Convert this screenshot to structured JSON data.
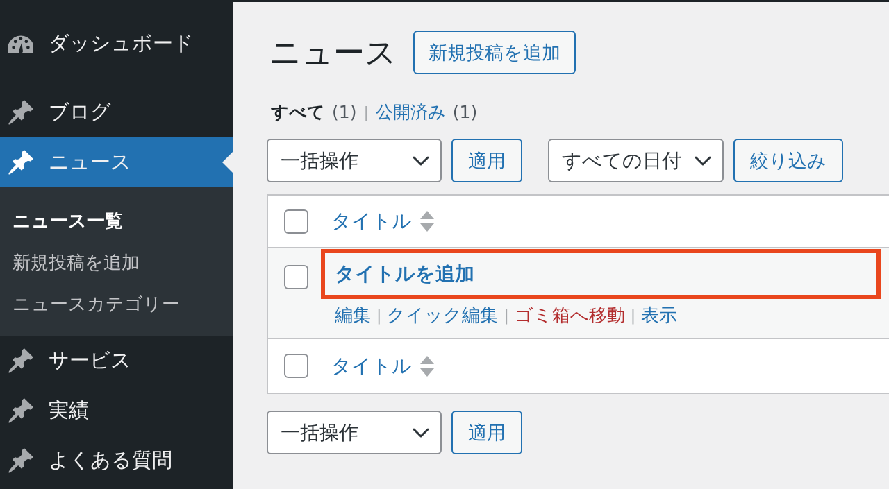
{
  "sidebar": {
    "items": [
      {
        "label": "ダッシュボード",
        "kind": "dashboard",
        "selected": false
      },
      {
        "label": "ブログ",
        "kind": "post",
        "selected": false
      },
      {
        "label": "ニュース",
        "kind": "post",
        "selected": true,
        "children": [
          {
            "label": "ニュース一覧",
            "selected": true
          },
          {
            "label": "新規投稿を追加",
            "selected": false
          },
          {
            "label": "ニュースカテゴリー",
            "selected": false
          }
        ]
      },
      {
        "label": "サービス",
        "kind": "post",
        "selected": false
      },
      {
        "label": "実績",
        "kind": "post",
        "selected": false
      },
      {
        "label": "よくある質問",
        "kind": "post",
        "selected": false
      }
    ]
  },
  "page": {
    "title": "ニュース",
    "add_button": "新規投稿を追加"
  },
  "views": [
    {
      "label": "すべて",
      "count": "(1)",
      "selected": true,
      "separator": "|"
    },
    {
      "label": "公開済み",
      "count": "(1)",
      "selected": false
    }
  ],
  "top_actions": {
    "bulk_select": "一括操作",
    "apply": "適用",
    "date_select": "すべての日付",
    "filter": "絞り込み"
  },
  "table": {
    "header": {
      "checked": false,
      "column": "タイトル"
    },
    "rows": [
      {
        "checked": false,
        "title": "タイトルを追加",
        "highlighted": true,
        "actions": [
          {
            "label": "編集",
            "kind": "normal",
            "separator": "|"
          },
          {
            "label": "クイック編集",
            "kind": "normal",
            "separator": "|"
          },
          {
            "label": "ゴミ箱へ移動",
            "kind": "danger",
            "separator": "|"
          },
          {
            "label": "表示",
            "kind": "normal"
          }
        ]
      }
    ],
    "footer": {
      "checked": false,
      "column": "タイトル"
    }
  },
  "bottom_actions": {
    "bulk_select": "一括操作",
    "apply": "適用"
  }
}
